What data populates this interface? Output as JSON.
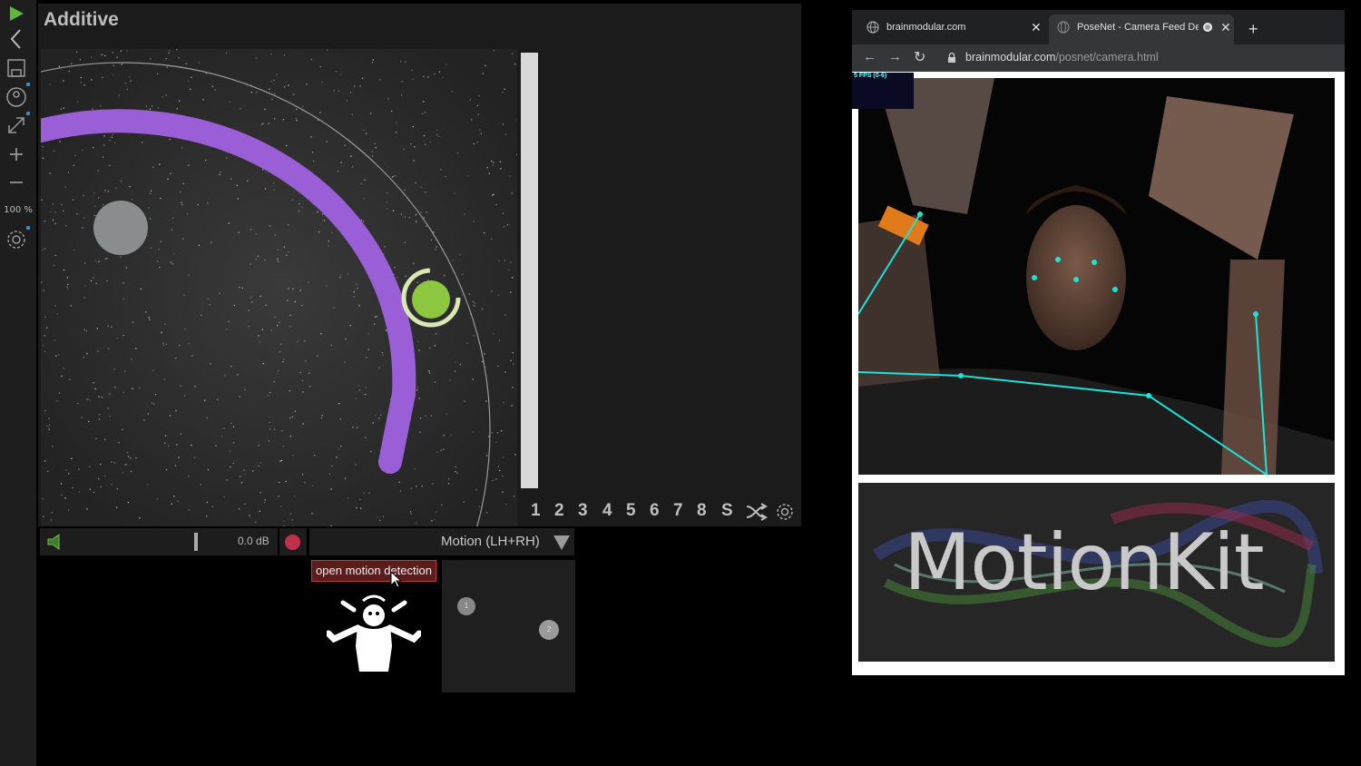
{
  "toolbar": {
    "zoom": "100 %",
    "icons": [
      "play-icon",
      "back-icon",
      "save-icon",
      "motion-icon",
      "expand-icon",
      "plus-icon",
      "minus-icon",
      "settings-icon"
    ]
  },
  "main": {
    "title": "Additive",
    "presets": [
      "1",
      "2",
      "3",
      "4",
      "5",
      "6",
      "7",
      "8",
      "S"
    ],
    "volume_db": "0.0 dB",
    "motion_selector": "Motion (LH+RH)",
    "tooltip": "open motion detection",
    "pad_points": [
      "1",
      "2"
    ]
  },
  "browser": {
    "tabs": [
      {
        "label": "brainmodular.com"
      },
      {
        "label": "PoseNet - Camera Feed Dem"
      }
    ],
    "url_domain": "brainmodular.com",
    "url_path": "/posnet/camera.html",
    "fps": "5 FPS (0-6)",
    "logo": "MotionKit"
  },
  "colors": {
    "accent_purple": "#9a5fd6",
    "accent_green": "#8dc63f",
    "pose_cyan": "#1de3d6",
    "record_red": "#c0304a"
  }
}
